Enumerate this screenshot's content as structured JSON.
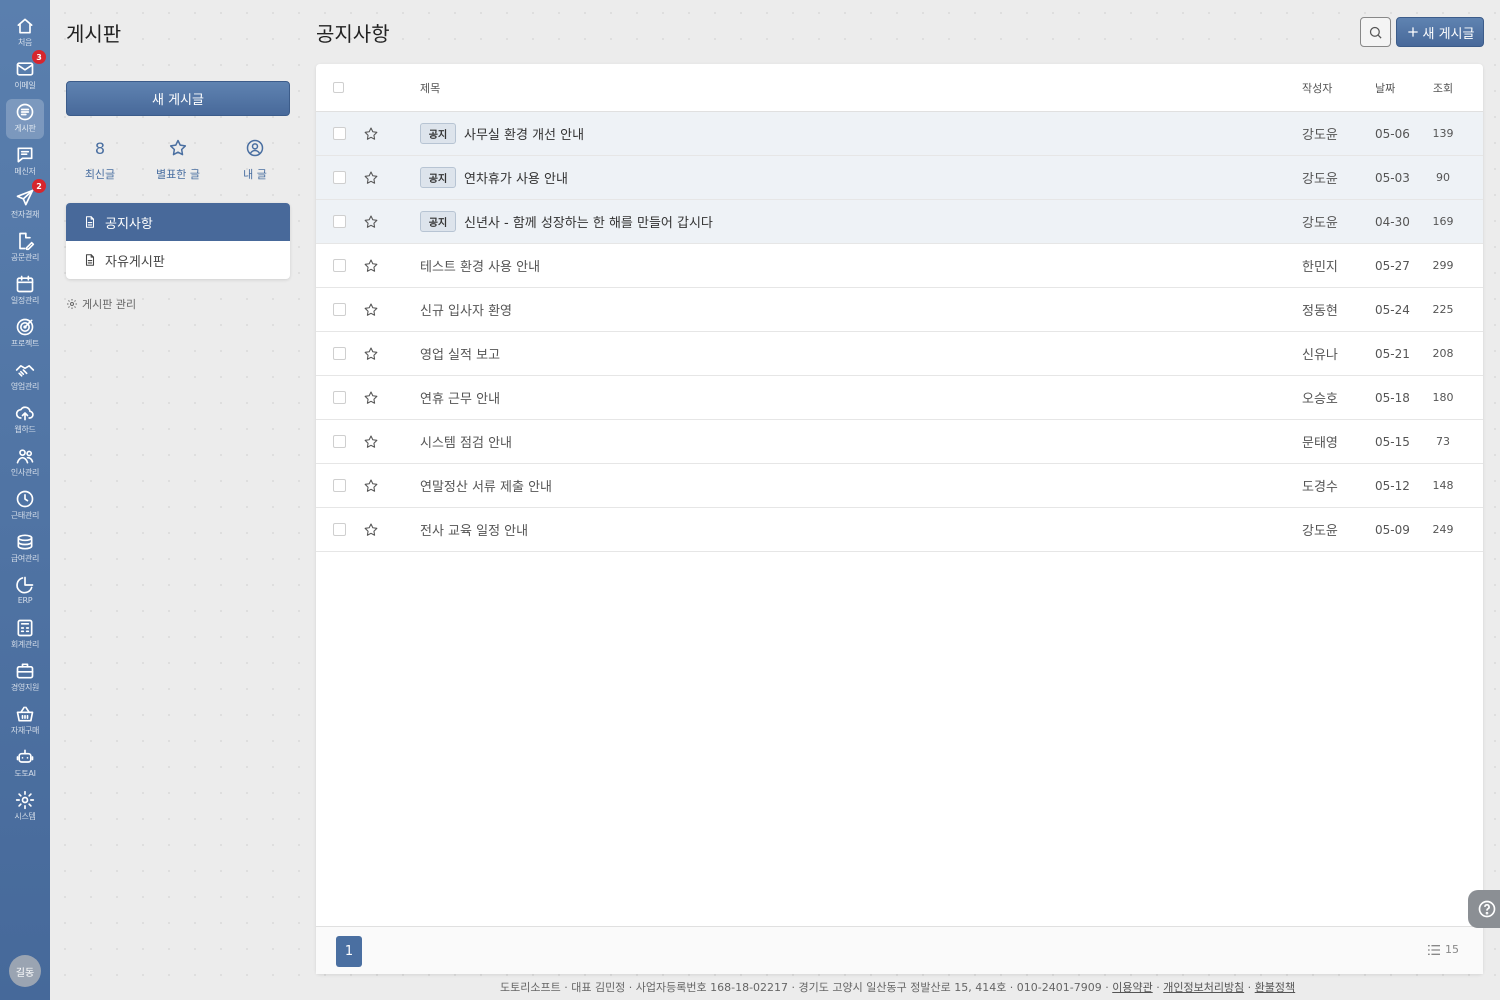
{
  "rail": {
    "items": [
      {
        "label": "처음",
        "icon": "home-icon",
        "badge": ""
      },
      {
        "label": "이메일",
        "icon": "mail-icon",
        "badge": "3"
      },
      {
        "label": "게시판",
        "icon": "board-icon",
        "badge": ""
      },
      {
        "label": "메신저",
        "icon": "messenger-icon",
        "badge": ""
      },
      {
        "label": "전자결재",
        "icon": "send-icon",
        "badge": "2"
      },
      {
        "label": "공문관리",
        "icon": "document-edit-icon",
        "badge": ""
      },
      {
        "label": "일정관리",
        "icon": "calendar-icon",
        "badge": ""
      },
      {
        "label": "프로젝트",
        "icon": "target-icon",
        "badge": ""
      },
      {
        "label": "영업관리",
        "icon": "handshake-icon",
        "badge": ""
      },
      {
        "label": "웹하드",
        "icon": "cloud-icon",
        "badge": ""
      },
      {
        "label": "인사관리",
        "icon": "people-icon",
        "badge": ""
      },
      {
        "label": "근태관리",
        "icon": "clock-icon",
        "badge": ""
      },
      {
        "label": "급여관리",
        "icon": "coins-icon",
        "badge": ""
      },
      {
        "label": "ERP",
        "icon": "pie-chart-icon",
        "badge": ""
      },
      {
        "label": "회계관리",
        "icon": "calculator-icon",
        "badge": ""
      },
      {
        "label": "경영지원",
        "icon": "briefcase-icon",
        "badge": ""
      },
      {
        "label": "자재구매",
        "icon": "basket-icon",
        "badge": ""
      },
      {
        "label": "도토AI",
        "icon": "robot-icon",
        "badge": ""
      },
      {
        "label": "시스템",
        "icon": "gear-icon",
        "badge": ""
      }
    ],
    "avatar": "길동"
  },
  "sidebar": {
    "title": "게시판",
    "new_post": "새 게시글",
    "quick": [
      {
        "value": "8",
        "label": "최신글"
      },
      {
        "label": "별표한 글"
      },
      {
        "label": "내 글"
      }
    ],
    "boards": [
      "공지사항",
      "자유게시판"
    ],
    "manage": "게시판 관리"
  },
  "main": {
    "title": "공지사항",
    "new_post": "새 게시글",
    "headers": {
      "title": "제목",
      "author": "작성자",
      "date": "날짜",
      "views": "조회"
    },
    "notice_tag": "공지",
    "rows": [
      {
        "notice": true,
        "title": "사무실 환경 개선 안내",
        "author": "강도윤",
        "date": "05-06",
        "views": "139"
      },
      {
        "notice": true,
        "title": "연차휴가 사용 안내",
        "author": "강도윤",
        "date": "05-03",
        "views": "90"
      },
      {
        "notice": true,
        "title": "신년사 - 함께 성장하는 한 해를 만들어 갑시다",
        "author": "강도윤",
        "date": "04-30",
        "views": "169"
      },
      {
        "notice": false,
        "title": "테스트 환경 사용 안내",
        "author": "한민지",
        "date": "05-27",
        "views": "299"
      },
      {
        "notice": false,
        "title": "신규 입사자 환영",
        "author": "정동현",
        "date": "05-24",
        "views": "225"
      },
      {
        "notice": false,
        "title": "영업 실적 보고",
        "author": "신유나",
        "date": "05-21",
        "views": "208"
      },
      {
        "notice": false,
        "title": "연휴 근무 안내",
        "author": "오승호",
        "date": "05-18",
        "views": "180"
      },
      {
        "notice": false,
        "title": "시스템 점검 안내",
        "author": "문태영",
        "date": "05-15",
        "views": "73"
      },
      {
        "notice": false,
        "title": "연말정산 서류 제출 안내",
        "author": "도경수",
        "date": "05-12",
        "views": "148"
      },
      {
        "notice": false,
        "title": "전사 교육 일정 안내",
        "author": "강도윤",
        "date": "05-09",
        "views": "249"
      }
    ],
    "page": "1",
    "page_size": "15"
  },
  "footer": {
    "info": "도토리소프트 · 대표 김민정 · 사업자등록번호 168-18-02217 · 경기도 고양시 일산동구 정발산로 15, 414호 · 010-2401-7909",
    "sep": " · ",
    "links": [
      "이용약관",
      "개인정보처리방침",
      "환불정책"
    ]
  }
}
